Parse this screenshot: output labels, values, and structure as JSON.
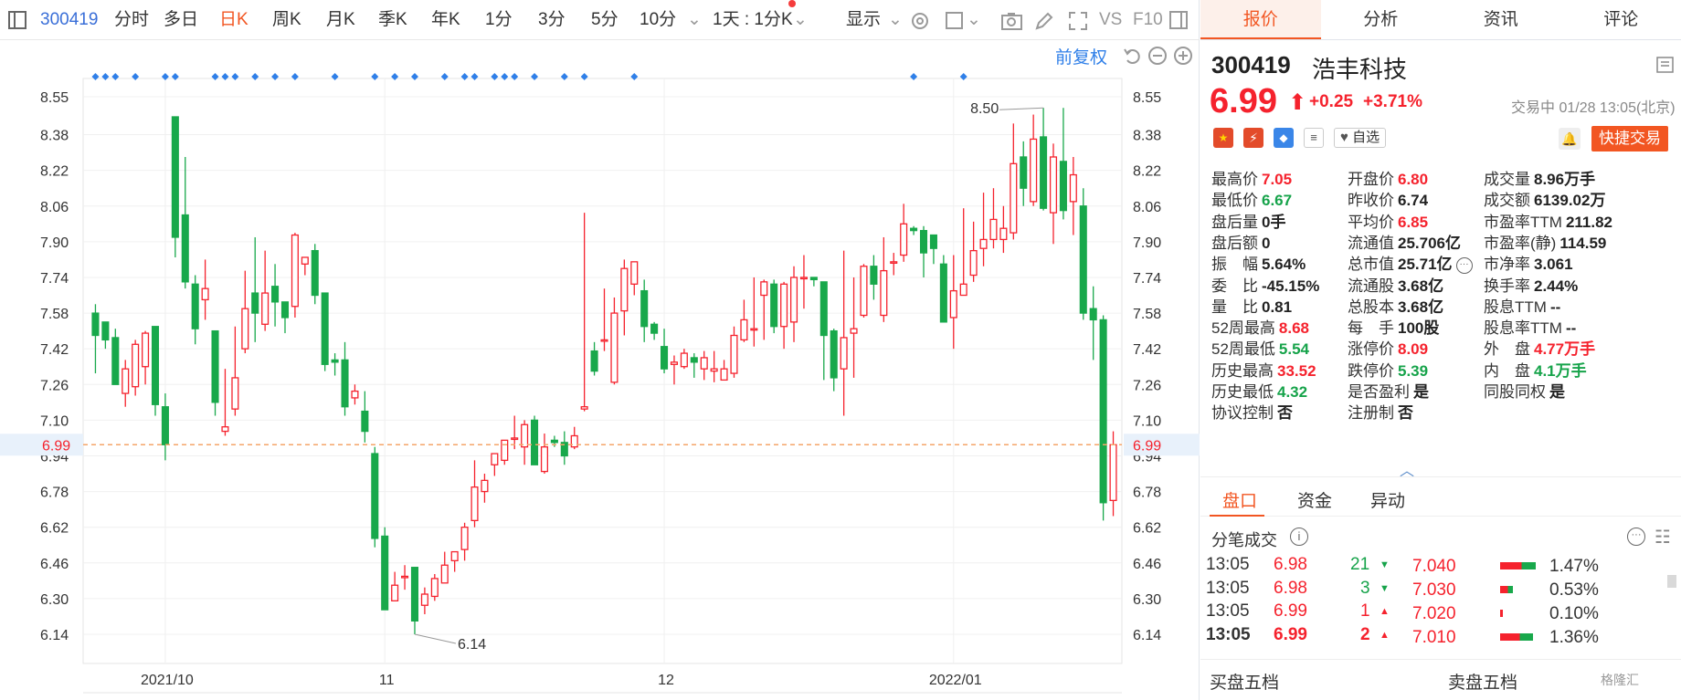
{
  "toolbar": {
    "code": "300419",
    "items": [
      "分时",
      "多日",
      "日K",
      "周K",
      "月K",
      "季K",
      "年K",
      "1分",
      "3分",
      "5分",
      "10分"
    ],
    "active": "日K",
    "range_select": "1天 : 1分K",
    "display": "显示",
    "vs": "VS",
    "f10": "F10"
  },
  "chart_toolbar": {
    "adjust": "前复权"
  },
  "chart_data": {
    "type": "candlestick",
    "y_ticks": [
      "8.55",
      "8.38",
      "8.22",
      "8.06",
      "7.90",
      "7.74",
      "7.58",
      "7.42",
      "7.26",
      "7.10",
      "6.94",
      "6.78",
      "6.62",
      "6.46",
      "6.30",
      "6.14"
    ],
    "ylim": [
      6.0,
      8.62
    ],
    "x_labels": [
      "2021/10",
      "11",
      "12",
      "2022/01"
    ],
    "x_label_positions": [
      7,
      29,
      57,
      86
    ],
    "current_price": "6.99",
    "high_label": "8.50",
    "low_label": "6.14",
    "candles": [
      [
        7.58,
        7.48,
        7.62,
        7.31
      ],
      [
        7.54,
        7.46,
        7.54,
        7.42
      ],
      [
        7.47,
        7.26,
        7.51,
        7.26
      ],
      [
        7.22,
        7.33,
        7.37,
        7.16
      ],
      [
        7.25,
        7.44,
        7.46,
        7.21
      ],
      [
        7.34,
        7.49,
        7.5,
        7.26
      ],
      [
        7.52,
        7.17,
        7.52,
        7.12
      ],
      [
        7.16,
        6.99,
        7.22,
        6.92
      ],
      [
        8.46,
        7.92,
        8.46,
        7.83
      ],
      [
        8.02,
        7.72,
        8.28,
        7.69
      ],
      [
        7.71,
        7.51,
        7.75,
        7.44
      ],
      [
        7.64,
        7.69,
        7.82,
        7.55
      ],
      [
        7.5,
        7.18,
        7.5,
        7.12
      ],
      [
        7.05,
        7.07,
        7.33,
        7.03
      ],
      [
        7.15,
        7.29,
        7.52,
        7.12
      ],
      [
        7.42,
        7.6,
        7.77,
        7.4
      ],
      [
        7.67,
        7.58,
        7.92,
        7.45
      ],
      [
        7.53,
        7.67,
        7.86,
        7.5
      ],
      [
        7.7,
        7.63,
        7.8,
        7.52
      ],
      [
        7.63,
        7.56,
        7.61,
        7.49
      ],
      [
        7.61,
        7.93,
        7.94,
        7.56
      ],
      [
        7.8,
        7.83,
        7.81,
        7.75
      ],
      [
        7.86,
        7.66,
        7.89,
        7.62
      ],
      [
        7.67,
        7.35,
        7.67,
        7.32
      ],
      [
        7.37,
        7.36,
        7.4,
        7.3
      ],
      [
        7.37,
        7.16,
        7.45,
        7.12
      ],
      [
        7.2,
        7.23,
        7.26,
        7.17
      ],
      [
        7.14,
        7.05,
        7.23,
        7.0
      ],
      [
        6.95,
        6.57,
        6.98,
        6.53
      ],
      [
        6.58,
        6.25,
        6.62,
        6.25
      ],
      [
        6.29,
        6.36,
        6.42,
        6.32
      ],
      [
        6.4,
        6.4,
        6.45,
        6.34
      ],
      [
        6.44,
        6.2,
        6.44,
        6.14
      ],
      [
        6.27,
        6.32,
        6.35,
        6.23
      ],
      [
        6.31,
        6.39,
        6.41,
        6.29
      ],
      [
        6.37,
        6.45,
        6.51,
        6.38
      ],
      [
        6.47,
        6.51,
        6.51,
        6.42
      ],
      [
        6.52,
        6.62,
        6.64,
        6.47
      ],
      [
        6.65,
        6.8,
        6.92,
        6.62
      ],
      [
        6.78,
        6.83,
        6.86,
        6.73
      ],
      [
        6.9,
        6.95,
        6.95,
        6.85
      ],
      [
        6.92,
        7.01,
        7.01,
        6.9
      ],
      [
        7.02,
        7.02,
        7.12,
        6.97
      ],
      [
        6.98,
        7.08,
        7.1,
        6.9
      ],
      [
        7.1,
        6.9,
        7.12,
        6.9
      ],
      [
        6.87,
        6.98,
        7.04,
        6.86
      ],
      [
        7.01,
        7.0,
        7.03,
        6.98
      ],
      [
        7.0,
        6.94,
        7.05,
        6.9
      ],
      [
        6.98,
        7.03,
        7.07,
        6.97
      ],
      [
        7.15,
        7.16,
        8.03,
        7.14
      ],
      [
        7.41,
        7.32,
        7.45,
        7.3
      ],
      [
        7.46,
        7.46,
        7.69,
        7.41
      ],
      [
        7.27,
        7.58,
        7.65,
        7.26
      ],
      [
        7.59,
        7.78,
        7.82,
        7.48
      ],
      [
        7.71,
        7.81,
        7.81,
        7.66
      ],
      [
        7.68,
        7.52,
        7.73,
        7.45
      ],
      [
        7.53,
        7.49,
        7.54,
        7.46
      ],
      [
        7.43,
        7.33,
        7.51,
        7.31
      ],
      [
        7.35,
        7.36,
        7.39,
        7.26
      ],
      [
        7.34,
        7.4,
        7.42,
        7.33
      ],
      [
        7.38,
        7.36,
        7.4,
        7.29
      ],
      [
        7.33,
        7.38,
        7.41,
        7.28
      ],
      [
        7.32,
        7.33,
        7.41,
        7.27
      ],
      [
        7.28,
        7.33,
        7.37,
        7.28
      ],
      [
        7.31,
        7.48,
        7.52,
        7.29
      ],
      [
        7.46,
        7.55,
        7.64,
        7.45
      ],
      [
        7.51,
        7.51,
        7.74,
        7.43
      ],
      [
        7.66,
        7.72,
        7.73,
        7.46
      ],
      [
        7.71,
        7.52,
        7.73,
        7.49
      ],
      [
        7.52,
        7.71,
        7.72,
        7.42
      ],
      [
        7.54,
        7.74,
        7.79,
        7.45
      ],
      [
        7.74,
        7.74,
        7.84,
        7.6
      ],
      [
        7.74,
        7.73,
        7.74,
        7.7
      ],
      [
        7.72,
        7.48,
        7.72,
        7.28
      ],
      [
        7.5,
        7.29,
        7.51,
        7.23
      ],
      [
        7.33,
        7.47,
        7.86,
        7.12
      ],
      [
        7.49,
        7.51,
        7.74,
        7.29
      ],
      [
        7.57,
        7.79,
        7.8,
        7.56
      ],
      [
        7.79,
        7.71,
        7.84,
        7.64
      ],
      [
        7.57,
        7.77,
        7.92,
        7.54
      ],
      [
        7.81,
        7.81,
        7.85,
        7.75
      ],
      [
        7.84,
        7.98,
        8.07,
        7.81
      ],
      [
        7.96,
        7.95,
        7.97,
        7.93
      ],
      [
        7.95,
        7.85,
        7.97,
        7.74
      ],
      [
        7.93,
        7.87,
        7.9,
        7.8
      ],
      [
        7.8,
        7.54,
        7.84,
        7.55
      ],
      [
        7.56,
        7.68,
        7.84,
        7.42
      ],
      [
        7.66,
        7.71,
        8.05,
        7.69
      ],
      [
        7.75,
        7.86,
        7.99,
        7.72
      ],
      [
        7.87,
        7.91,
        8.12,
        7.79
      ],
      [
        7.91,
        8.0,
        8.14,
        7.87
      ],
      [
        7.91,
        7.96,
        8.06,
        7.85
      ],
      [
        7.94,
        8.25,
        8.43,
        7.91
      ],
      [
        8.28,
        8.14,
        8.35,
        8.06
      ],
      [
        8.08,
        8.36,
        8.47,
        8.06
      ],
      [
        8.37,
        8.05,
        8.5,
        8.04
      ],
      [
        8.03,
        8.28,
        8.34,
        7.89
      ],
      [
        8.26,
        8.04,
        8.5,
        8.0
      ],
      [
        8.08,
        8.2,
        8.28,
        7.93
      ],
      [
        8.06,
        7.58,
        8.14,
        7.55
      ],
      [
        7.6,
        7.55,
        7.7,
        7.37
      ],
      [
        7.55,
        6.73,
        7.57,
        6.65
      ],
      [
        6.74,
        6.99,
        7.05,
        6.67
      ]
    ],
    "marker_index": [
      0,
      1,
      2,
      4,
      7,
      8,
      12,
      13,
      14,
      16,
      18,
      20,
      24,
      28,
      30,
      32,
      35,
      37,
      38,
      40,
      41,
      42,
      44,
      47,
      49,
      54,
      82,
      87
    ]
  },
  "stock": {
    "code": "300419",
    "name": "浩丰科技",
    "price": "6.99",
    "arrow": "⬆",
    "change": "+0.25",
    "pct": "+3.71%",
    "status": "交易中 01/28 13:05(北京)",
    "watch": "自选",
    "trade": "快捷交易"
  },
  "quote": {
    "rows": [
      [
        {
          "l": "最高价",
          "v": "7.05",
          "c": "red"
        },
        {
          "l": "开盘价",
          "v": "6.80",
          "c": "red"
        },
        {
          "l": "成交量",
          "v": "8.96万手",
          "c": ""
        }
      ],
      [
        {
          "l": "最低价",
          "v": "6.67",
          "c": "green"
        },
        {
          "l": "昨收价",
          "v": "6.74",
          "c": ""
        },
        {
          "l": "成交额",
          "v": "6139.02万",
          "c": ""
        }
      ],
      [
        {
          "l": "盘后量",
          "v": "0手",
          "c": ""
        },
        {
          "l": "平均价",
          "v": "6.85",
          "c": "red"
        },
        {
          "l": "市盈率TTM",
          "v": "211.82",
          "c": ""
        }
      ],
      [
        {
          "l": "盘后额",
          "v": "0",
          "c": ""
        },
        {
          "l": "流通值",
          "v": "25.706亿",
          "c": ""
        },
        {
          "l": "市盈率(静)",
          "v": "114.59",
          "c": ""
        }
      ],
      [
        {
          "l": "振　幅",
          "v": "5.64%",
          "c": ""
        },
        {
          "l": "总市值",
          "v": "25.71亿",
          "c": ""
        },
        {
          "l": "市净率",
          "v": "3.061",
          "c": ""
        }
      ],
      [
        {
          "l": "委　比",
          "v": "-45.15%",
          "c": ""
        },
        {
          "l": "流通股",
          "v": "3.68亿",
          "c": ""
        },
        {
          "l": "换手率",
          "v": "2.44%",
          "c": ""
        }
      ],
      [
        {
          "l": "量　比",
          "v": "0.81",
          "c": ""
        },
        {
          "l": "总股本",
          "v": "3.68亿",
          "c": ""
        },
        {
          "l": "股息TTM",
          "v": "--",
          "c": ""
        }
      ],
      [
        {
          "l": "52周最高",
          "v": "8.68",
          "c": "red"
        },
        {
          "l": "每　手",
          "v": "100股",
          "c": ""
        },
        {
          "l": "股息率TTM",
          "v": "--",
          "c": ""
        }
      ],
      [
        {
          "l": "52周最低",
          "v": "5.54",
          "c": "green"
        },
        {
          "l": "涨停价",
          "v": "8.09",
          "c": "red"
        },
        {
          "l": "外　盘",
          "v": "4.77万手",
          "c": "red"
        }
      ],
      [
        {
          "l": "历史最高",
          "v": "33.52",
          "c": "red"
        },
        {
          "l": "跌停价",
          "v": "5.39",
          "c": "green"
        },
        {
          "l": "内　盘",
          "v": "4.1万手",
          "c": "green"
        }
      ],
      [
        {
          "l": "历史最低",
          "v": "4.32",
          "c": "green"
        },
        {
          "l": "是否盈利",
          "v": "是",
          "c": ""
        },
        {
          "l": "同股同权",
          "v": "是",
          "c": ""
        }
      ],
      [
        {
          "l": "协议控制",
          "v": "否",
          "c": ""
        },
        {
          "l": "注册制",
          "v": "否",
          "c": ""
        },
        {
          "l": "",
          "v": "",
          "c": ""
        }
      ]
    ]
  },
  "tabs": [
    "报价",
    "分析",
    "资讯",
    "评论"
  ],
  "subtabs": [
    "盘口",
    "资金",
    "异动"
  ],
  "tick": {
    "title": "分笔成交",
    "rows": [
      {
        "t": "13:05",
        "p": "6.98",
        "v": "21",
        "dir": "down"
      },
      {
        "t": "13:05",
        "p": "6.98",
        "v": "3",
        "dir": "down"
      },
      {
        "t": "13:05",
        "p": "6.99",
        "v": "1",
        "dir": "up"
      },
      {
        "t": "13:05",
        "p": "6.99",
        "v": "2",
        "dir": "up"
      }
    ],
    "dist": [
      {
        "p": "7.040",
        "pct": "1.47%",
        "share": 1.47
      },
      {
        "p": "7.030",
        "pct": "0.53%",
        "share": 0.53
      },
      {
        "p": "7.020",
        "pct": "0.10%",
        "share": 0.1
      },
      {
        "p": "7.010",
        "pct": "1.36%",
        "share": 1.36
      }
    ]
  },
  "bottom": {
    "buy": "买盘五档",
    "sell": "卖盘五档",
    "watermark": "格隆汇"
  },
  "colors": {
    "up": "#f5222d",
    "down": "#18a84b",
    "accent": "#f25622",
    "blue": "#2f7fe8"
  }
}
